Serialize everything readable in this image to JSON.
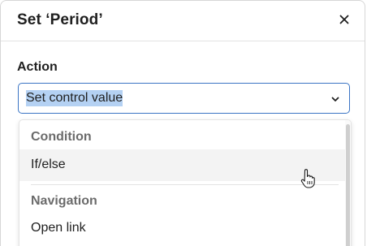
{
  "dialog": {
    "title": "Set ‘Period’",
    "close_icon": "close-icon"
  },
  "action_field": {
    "label": "Action",
    "selected_value": "Set control value",
    "chevron_icon": "chevron-down-icon",
    "focus_color": "#3a74c4",
    "selection_color": "#b4d1f3"
  },
  "dropdown": {
    "groups": [
      {
        "header": "Condition",
        "options": [
          {
            "label": "If/else",
            "hovered": true
          }
        ]
      },
      {
        "header": "Navigation",
        "options": [
          {
            "label": "Open link",
            "hovered": false
          }
        ]
      }
    ],
    "hover_color": "#f3f3f3"
  },
  "cursor": {
    "icon": "hand-pointer-icon"
  }
}
